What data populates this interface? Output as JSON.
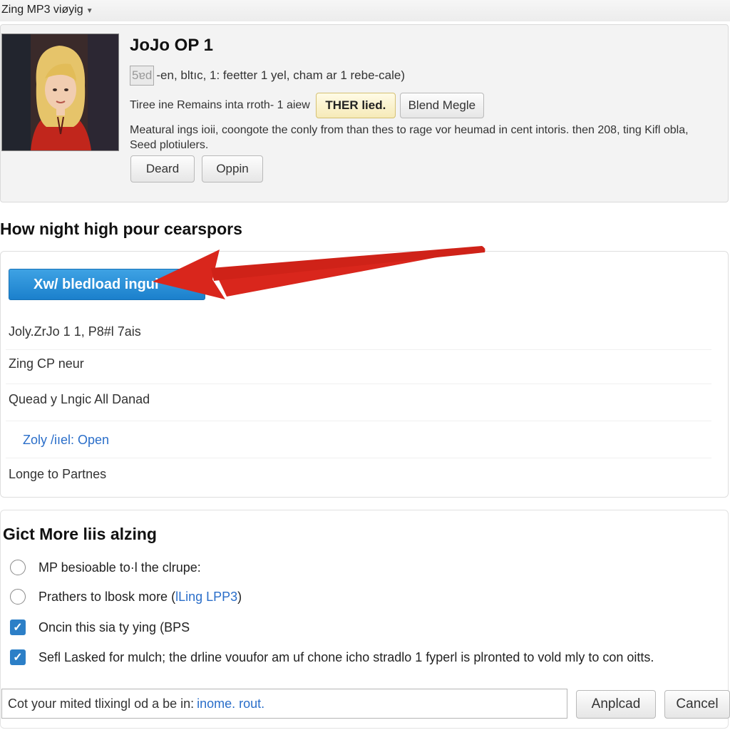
{
  "app": {
    "title": "Zing MP3 viøyig",
    "dropdown_icon": "caret-down-icon"
  },
  "song": {
    "title": "JoJo OP 1",
    "meta_box": "5ɐd",
    "meta_text": "-en, bltıc, 1: feetter 1 yel, cham ar 1 rebe-cale)",
    "action_text": "Tiree ine Remains inta rroth- 1 aiew",
    "badge_label": "THER lied.",
    "blend_button": "Blend Megle",
    "description": "Meatural ings ioii, coongote the conly from than thes to rage vor heumad in cent intoris. then 208, ting Kifl obla, Seed plotiulers.",
    "button_deard": "Deard",
    "button_oppin": "Oppin"
  },
  "download_section": {
    "heading": "How night high pour cearspors",
    "download_button": "Xw/ bledload ingui",
    "options": [
      "Joly.ZrJo 1 1, P8#l 7ais",
      "Zing CP neur",
      "Quead y Lngic All Danad",
      "Zoly /iıel: Open",
      "Longe to Partnes"
    ]
  },
  "more_section": {
    "heading": "Gict More liis alzing",
    "radio_1": "MP besioable to·l the clrupe:",
    "radio_2_prefix": "Prathers to lbosk more (",
    "radio_2_link": "lLing LPP3",
    "radio_2_suffix": ")",
    "check_1": "Oncin this sia ty ying (BPS",
    "check_2": "Sefl Lasked for mulch; the drline vouufor am uf chone icho stradlo 1 fyperl is plronted to vold mly to con oitts."
  },
  "footer": {
    "input_prefix": "Cot your mited tlixingl od a be in: ",
    "input_link": "inome. rout.",
    "upload_button": "Anplcad",
    "cancel_button": "Cancel"
  },
  "colors": {
    "accent_blue": "#1b80cc",
    "arrow_red": "#d9261c",
    "badge_yellow": "#f6eab8",
    "link_blue": "#2a6ec9"
  }
}
